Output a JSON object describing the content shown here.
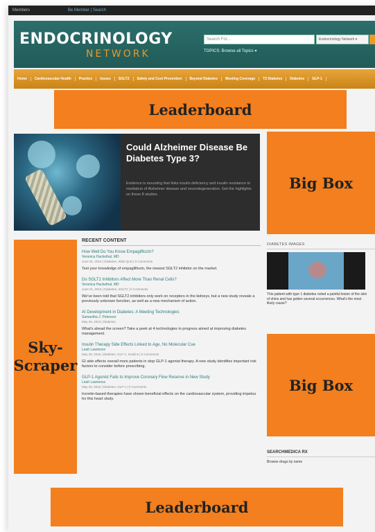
{
  "topbar": {
    "left_text": "Members",
    "links_text": "Be Member | Search"
  },
  "header": {
    "logo_main": "ENDOCRINOLOGY",
    "logo_sub": "NETWORK",
    "search_placeholder": "Search For...",
    "search_select": "Endocrinology Network ▾",
    "topics_label": "TOPICS: Browse all Topics ▾"
  },
  "nav": {
    "items": [
      "Home",
      "Cardiovascular Health",
      "Practice",
      "Issues",
      "SGLT2",
      "Safety and Cost Prevention",
      "Beyond Diabetes",
      "Meeting Coverage",
      "T2 Diabetes",
      "Diabetes",
      "GLP-1"
    ]
  },
  "ads": {
    "leaderboard_top": "Leaderboard",
    "bigbox_1": "Big Box",
    "bigbox_2": "Big Box",
    "skyscraper_line1": "Sky-",
    "skyscraper_line2": "Scraper",
    "leaderboard_bottom": "Leaderboard"
  },
  "hero": {
    "title": "Could Alzheimer Disease Be Diabetes Type 3?",
    "description": "Evidence is mounting that links insulin deficiency and insulin resistance to mediators of Alzheimer disease and neurodegeneration. Get the highlights on these 8 studies."
  },
  "recent": {
    "heading": "RECENT CONTENT",
    "articles": [
      {
        "title": "How Well Do You Know Empagliflozin?",
        "author": "Veronica Hackethal, MD",
        "meta": "June 01, 2015 | Diabetes, Slide Quiz | 0 Comments",
        "body": "Test your knowledge of empagliflozin, the newest SGLT2 inhibitor on the market."
      },
      {
        "title": "Do SGLT2 Inhibitors Affect More Than Renal Cells?",
        "author": "Veronica Hackethal, MD",
        "meta": "June 01, 2015 | Diabetes, SGLT2 | 0 Comments",
        "body": "We've been told that SGLT2 inhibitors only work on receptors in the kidneys, but a new study reveals a previously unknown function, as well as a new mechanism of action."
      },
      {
        "title": "AI Development in Diabetes: A Meeting Technologies",
        "author": "Samantha J. Peterson",
        "meta": "May 29, 2015 | Diabetes",
        "body": "What's ahead the screen? Take a peek at 4 technologies in progress aimed at improving diabetes management."
      },
      {
        "title": "Insulin Therapy Side Effects Linked to Age, No Molecular Cue",
        "author": "Leah Lawrence",
        "meta": "May 28, 2015 | Diabetes, GLP-1, Insulins | 0 Comments",
        "body": "GI side effects overall more patients in stop GLP-1 agonist therapy. A new study identifies important risk factors to consider before prescribing."
      },
      {
        "title": "GLP-1 Agonist Fails to Improve Coronary Flow Reserve in New Study",
        "author": "Leah Lawrence",
        "meta": "May 28, 2015 | Diabetes, GLP-1 | 0 Comments",
        "body": "Incretin-based therapies have shown beneficial effects on the cardiovascular system, providing impetus for this heart study."
      }
    ]
  },
  "sidebar": {
    "images_heading": "DIABETES IMAGES",
    "images_caption": "This patient with type 1 diabetes noted a painful lesion of the skin of shins and has gotten several occurrences. What's the most likely cause?",
    "searchmedica_heading": "SEARCHMEDICA RX",
    "searchmedica_text": "Browse drugs by name"
  },
  "colors": {
    "ad_orange": "#f37f1e",
    "header_teal": "#215b58",
    "nav_gold": "#d8921f",
    "link_teal": "#2a7c74"
  }
}
